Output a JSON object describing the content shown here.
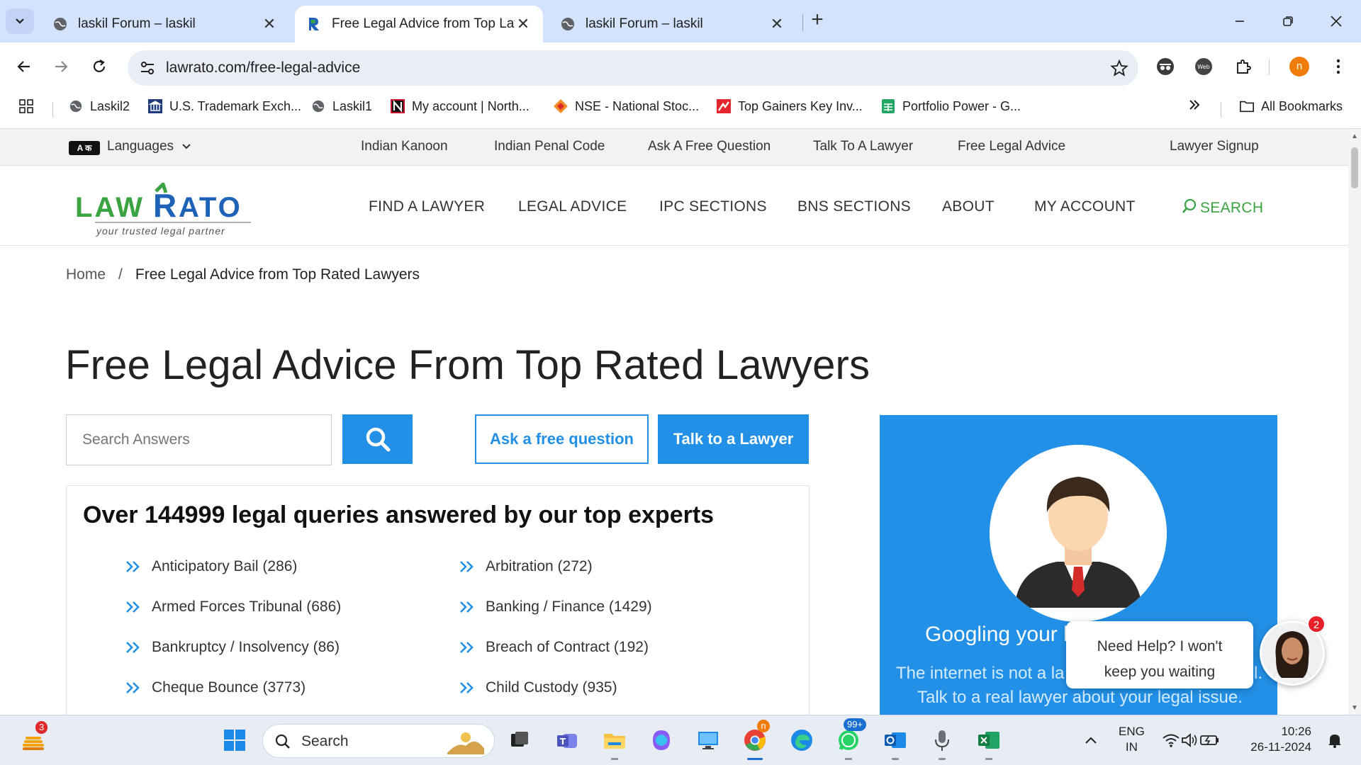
{
  "browser": {
    "tabs": [
      {
        "title": "laskil Forum – laskil",
        "active": false
      },
      {
        "title": "Free Legal Advice from Top Law",
        "active": true
      },
      {
        "title": "laskil Forum – laskil",
        "active": false
      }
    ],
    "url": "lawrato.com/free-legal-advice",
    "profile_initial": "n",
    "bookmarks": [
      {
        "label": "Laskil2"
      },
      {
        "label": "U.S. Trademark Exch..."
      },
      {
        "label": "Laskil1"
      },
      {
        "label": "My account | North..."
      },
      {
        "label": "NSE - National Stoc..."
      },
      {
        "label": "Top Gainers Key Inv..."
      },
      {
        "label": "Portfolio Power - G..."
      }
    ],
    "all_bookmarks": "All Bookmarks"
  },
  "site": {
    "topbar": {
      "lang_badge": "A क",
      "languages": "Languages",
      "links": [
        "Indian Kanoon",
        "Indian Penal Code",
        "Ask A Free Question",
        "Talk To A Lawyer",
        "Free Legal Advice"
      ],
      "signup": "Lawyer Signup"
    },
    "logo": {
      "name": "LAWRATO",
      "tagline": "your trusted legal partner"
    },
    "nav": [
      "FIND A LAWYER",
      "LEGAL ADVICE",
      "IPC SECTIONS",
      "BNS SECTIONS",
      "ABOUT",
      "MY ACCOUNT"
    ],
    "nav_search": "SEARCH",
    "breadcrumb": {
      "home": "Home",
      "separator": "/",
      "current": "Free Legal Advice from Top Rated Lawyers"
    },
    "title": "Free Legal Advice From Top Rated Lawyers",
    "search": {
      "placeholder": "Search Answers"
    },
    "ask_button": "Ask a free question",
    "talk_button": "Talk to a Lawyer",
    "queries_heading": "Over 144999 legal queries answered by our top experts",
    "categories": [
      {
        "label": "Anticipatory Bail (286)"
      },
      {
        "label": "Arbitration (272)"
      },
      {
        "label": "Armed Forces Tribunal (686)"
      },
      {
        "label": "Banking / Finance (1429)"
      },
      {
        "label": "Bankruptcy / Insolvency (86)"
      },
      {
        "label": "Breach of Contract (192)"
      },
      {
        "label": "Cheque Bounce (3773)"
      },
      {
        "label": "Child Custody (935)"
      }
    ],
    "promo": {
      "heading": "Googling your l",
      "line1": "The internet is not a la",
      "line1_end": "l.",
      "line2": "Talk to a real lawyer about your legal issue."
    },
    "chat": {
      "line1": "Need Help? I won't",
      "line2": "keep you waiting",
      "badge": "2"
    }
  },
  "taskbar": {
    "widget_badge": "3",
    "search_label": "Search",
    "whatsapp_badge": "99+",
    "chrome_badge": "n",
    "lang_line1": "ENG",
    "lang_line2": "IN",
    "time": "10:26",
    "date": "26-11-2024"
  },
  "colors": {
    "accent": "#2290e6",
    "logo_green": "#3aa342",
    "logo_blue": "#1f63b8",
    "chrome_tab_bg": "#d3e3fd"
  }
}
